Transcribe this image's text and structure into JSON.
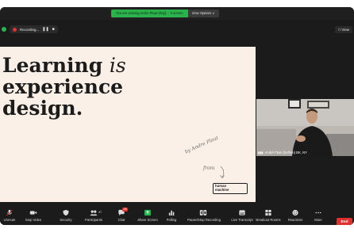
{
  "top_bar": {
    "share_message": "You are viewing Andre Plaut (Reji)... 's screen",
    "view_options_label": "View Options ∨"
  },
  "recording": {
    "label": "Recording...",
    "pause_glyph": "❚❚",
    "stop_glyph": "■"
  },
  "view_button_label": "□ View",
  "slide": {
    "heading_line1_a": "Learning ",
    "heading_line1_b": "is",
    "heading_line2": "experience",
    "heading_line3": "design.",
    "handwriting_line1": "by Andre Plaut",
    "handwriting_line2": "from",
    "logo_line1": "human",
    "logo_line2": "machine"
  },
  "participant": {
    "caption": "André Plaut (he/him) BK, NY"
  },
  "toolbar": {
    "items": [
      {
        "label": "Unmute",
        "icon": "microphone-muted-icon"
      },
      {
        "label": "Stop Video",
        "icon": "video-camera-icon"
      },
      {
        "label": "Security",
        "icon": "shield-icon"
      },
      {
        "label": "Participants",
        "icon": "participants-icon",
        "count": "47"
      },
      {
        "label": "Chat",
        "icon": "chat-icon",
        "badge": "28"
      },
      {
        "label": "Share Screen",
        "icon": "share-screen-icon"
      },
      {
        "label": "Polling",
        "icon": "polling-icon"
      },
      {
        "label": "Pause/Stop Recording",
        "icon": "recording-icon"
      },
      {
        "label": "Live Transcript",
        "icon": "transcript-icon"
      },
      {
        "label": "Breakout Rooms",
        "icon": "breakout-rooms-icon"
      },
      {
        "label": "Reactions",
        "icon": "reactions-icon"
      },
      {
        "label": "More",
        "icon": "more-icon"
      }
    ],
    "end_label": "End"
  },
  "colors": {
    "accent_green": "#2bb24c",
    "end_red": "#e03131",
    "slide_bg": "#fbf0e8"
  }
}
